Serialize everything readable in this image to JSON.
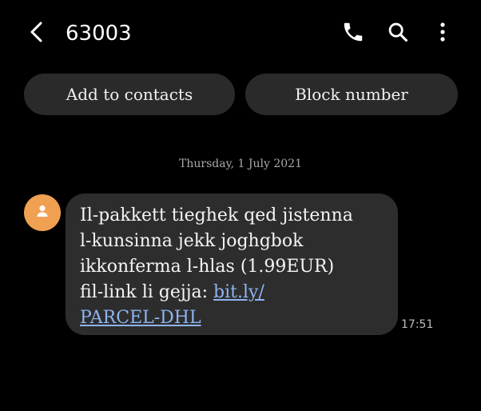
{
  "header": {
    "title": "63003",
    "back_icon": "chevron-left-icon",
    "actions": [
      "phone-icon",
      "search-icon",
      "more-vert-icon"
    ]
  },
  "actions": {
    "add_to_contacts": "Add to contacts",
    "block_number": "Block number"
  },
  "conversation": {
    "date": "Thursday, 1 July 2021",
    "message": {
      "lines": [
        "Il-pakkett tieghek qed jistenna",
        "l-kunsinna jekk joghgbok",
        "ikkonferma l-hlas (1.99EUR)"
      ],
      "last_line_prefix": "fil-link li gejja: ",
      "link_text": "bit.ly/",
      "link_text_2": "PARCEL-DHL",
      "time": "17:51"
    }
  },
  "colors": {
    "background": "#000000",
    "button_bg": "#2a2a2a",
    "bubble_bg": "#2d2d2d",
    "avatar": "#f0a051",
    "link": "#8fb4f0"
  }
}
